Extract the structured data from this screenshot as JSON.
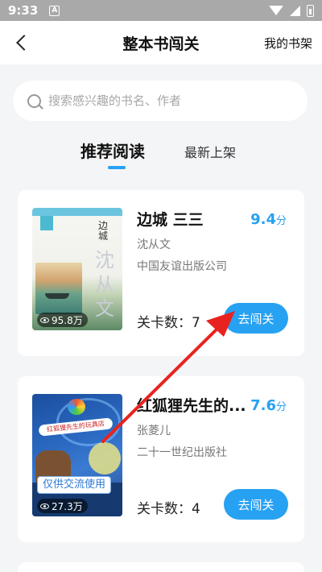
{
  "status_bar": {
    "time": "9:33",
    "notification_icon": "A"
  },
  "nav": {
    "title": "整本书闯关",
    "right_link": "我的书架"
  },
  "search": {
    "placeholder": "搜索感兴趣的书名、作者"
  },
  "tabs": [
    {
      "label": "推荐阅读",
      "active": true
    },
    {
      "label": "最新上架",
      "active": false
    }
  ],
  "books": [
    {
      "title": "边城 三三",
      "author": "沈从文",
      "publisher": "中国友谊出版公司",
      "rating": "9.4",
      "rating_unit": "分",
      "views": "95.8万",
      "levels_label": "关卡数：7",
      "button": "去闯关",
      "cover_title": "边城",
      "cover_big_text": "沈从文"
    },
    {
      "title": "红狐狸先生的...",
      "author": "张菱儿",
      "publisher": "二十一世纪出版社",
      "rating": "7.6",
      "rating_unit": "分",
      "views": "27.3万",
      "levels_label": "关卡数：4",
      "button": "去闯关",
      "cover_ribbon": "红狐狸先生的玩具店",
      "overlay_tag": "仅供交流使用"
    }
  ],
  "colors": {
    "accent": "#27a1f2",
    "annotation_arrow": "#e8231f"
  }
}
